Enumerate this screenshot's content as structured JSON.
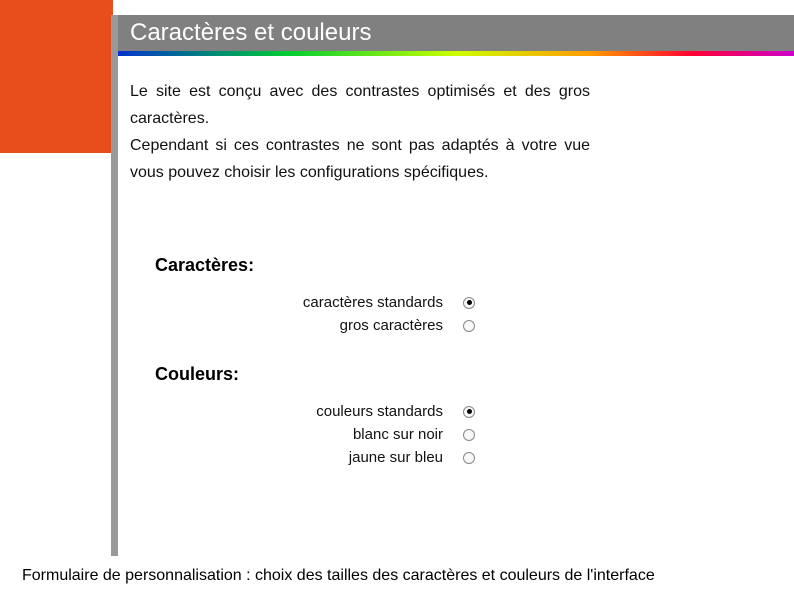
{
  "header": {
    "title": "Caractères et couleurs"
  },
  "description": {
    "para1": "Le site est conçu avec des contrastes optimisés et des gros caractères.",
    "para2": "Cependant si ces contrastes ne sont pas adaptés à votre vue vous pouvez choisir les configurations spécifiques."
  },
  "sections": {
    "characters": {
      "heading": "Caractères:",
      "options": [
        {
          "label": "caractères standards",
          "selected": true
        },
        {
          "label": "gros caractères",
          "selected": false
        }
      ]
    },
    "colors": {
      "heading": "Couleurs:",
      "options": [
        {
          "label": "couleurs standards",
          "selected": true
        },
        {
          "label": "blanc sur noir",
          "selected": false
        },
        {
          "label": "jaune sur bleu",
          "selected": false
        }
      ]
    }
  },
  "caption": "Formulaire de personnalisation : choix des tailles des caractères et couleurs de l'interface"
}
